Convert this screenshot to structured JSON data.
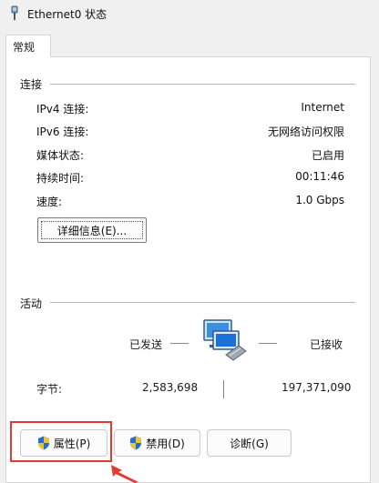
{
  "window": {
    "title": "Ethernet0 状态",
    "tab_label": "常规"
  },
  "connection": {
    "group_label": "连接",
    "rows": [
      {
        "label": "IPv4 连接:",
        "value": "Internet"
      },
      {
        "label": "IPv6 连接:",
        "value": "无网络访问权限"
      },
      {
        "label": "媒体状态:",
        "value": "已启用"
      },
      {
        "label": "持续时间:",
        "value": "00:11:46"
      },
      {
        "label": "速度:",
        "value": "1.0 Gbps"
      }
    ],
    "details_button": "详细信息(E)..."
  },
  "activity": {
    "group_label": "活动",
    "sent_label": "已发送",
    "received_label": "已接收",
    "bytes_label": "字节:",
    "bytes_sent": "2,583,698",
    "bytes_received": "197,371,090"
  },
  "buttons": {
    "properties": "属性(P)",
    "disable": "禁用(D)",
    "diagnose": "诊断(G)"
  },
  "colors": {
    "highlight": "#e53935",
    "shield_blue": "#1e6fd9",
    "shield_yellow": "#f2c12e"
  },
  "icons": {
    "title": "network-adapter-icon",
    "activity": "network-computers-icon",
    "button_shield": "uac-shield-icon"
  }
}
